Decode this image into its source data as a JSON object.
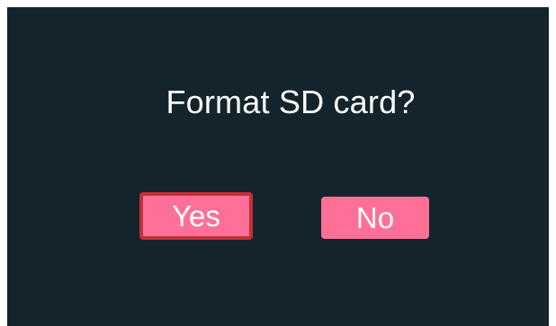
{
  "dialog": {
    "question": "Format SD card?",
    "confirm_label": "Yes",
    "cancel_label": "No"
  },
  "colors": {
    "background": "#13242c",
    "button_fill": "#ff7098",
    "focus_border": "#c2303a",
    "text": "#ffffff"
  },
  "state": {
    "focused_button": "Yes"
  }
}
